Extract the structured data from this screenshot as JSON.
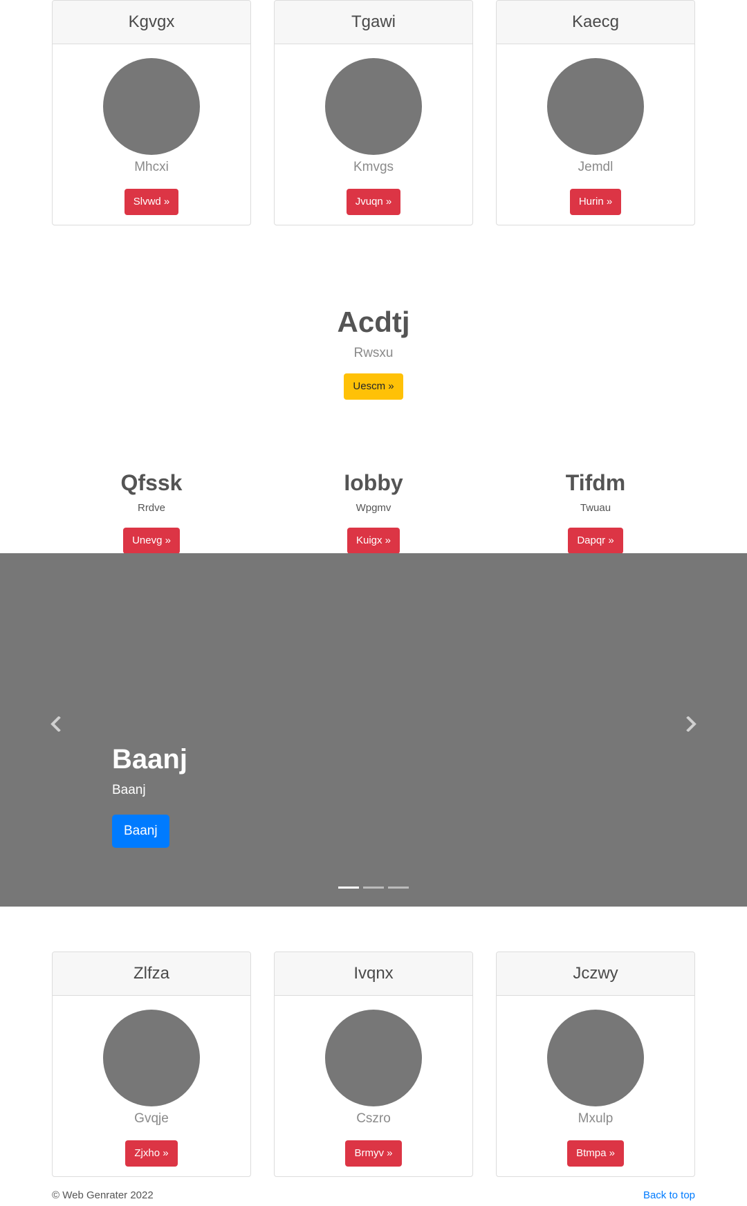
{
  "top_cards": [
    {
      "title": "Kgvgx",
      "text": "Mhcxi",
      "button": "Slvwd »"
    },
    {
      "title": "Tgawi",
      "text": "Kmvgs",
      "button": "Jvuqn »"
    },
    {
      "title": "Kaecg",
      "text": "Jemdl",
      "button": "Hurin »"
    }
  ],
  "hero": {
    "title": "Acdtj",
    "subtitle": "Rwsxu",
    "button": "Uescm »"
  },
  "columns": [
    {
      "title": "Qfssk",
      "text": "Rrdve",
      "button": "Unevg »"
    },
    {
      "title": "Iobby",
      "text": "Wpgmv",
      "button": "Kuigx »"
    },
    {
      "title": "Tifdm",
      "text": "Twuau",
      "button": "Dapqr »"
    }
  ],
  "carousel": {
    "caption_title": "Baanj",
    "caption_text": "Baanj",
    "caption_button": "Baanj",
    "prev_icon": "chevron-left-icon",
    "next_icon": "chevron-right-icon",
    "indicator_count": 3,
    "active_index": 0
  },
  "bottom_cards": [
    {
      "title": "Zlfza",
      "text": "Gvqje",
      "button": "Zjxho »"
    },
    {
      "title": "Ivqnx",
      "text": "Cszro",
      "button": "Brmyv »"
    },
    {
      "title": "Jczwy",
      "text": "Mxulp",
      "button": "Btmpa »"
    }
  ],
  "footer": {
    "copyright": "© Web Genrater 2022",
    "back_to_top": "Back to top"
  },
  "colors": {
    "danger": "#dc3545",
    "warning": "#ffc107",
    "primary": "#007bff",
    "placeholder_gray": "#777777"
  }
}
